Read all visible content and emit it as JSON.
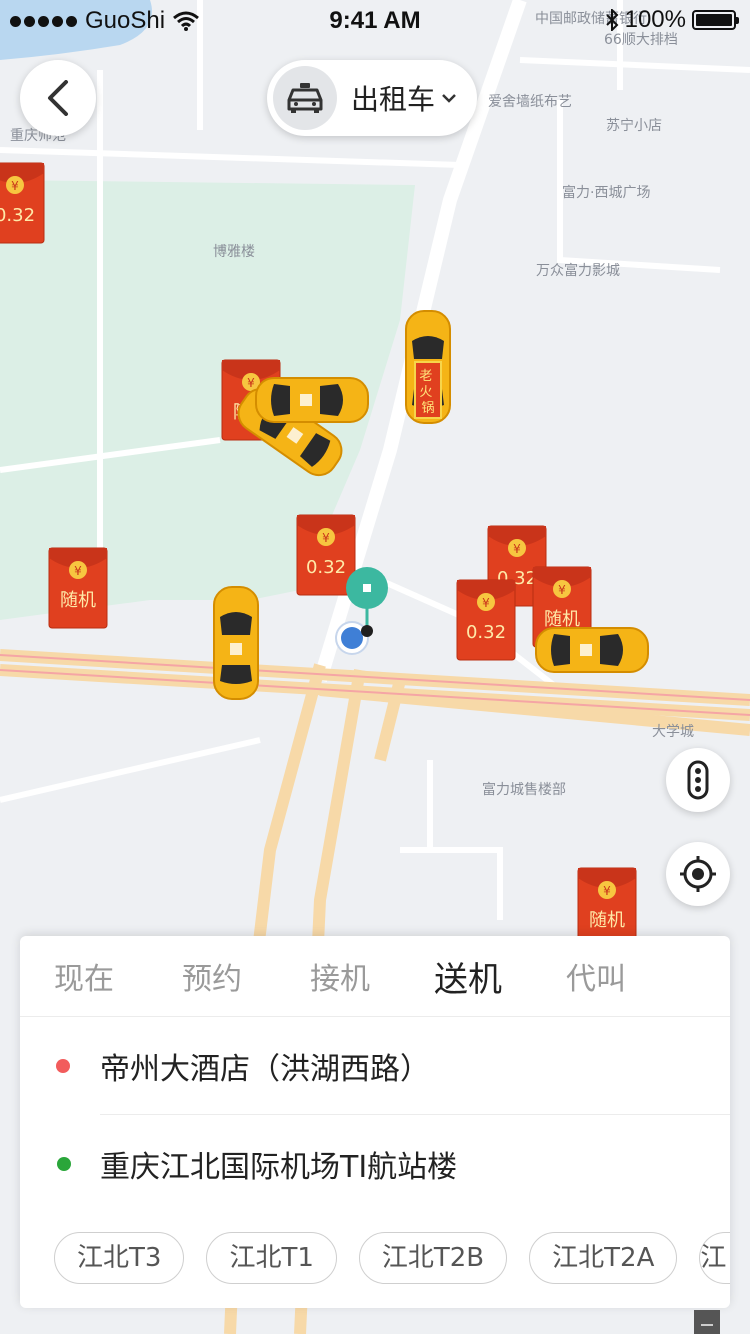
{
  "status_bar": {
    "carrier": "GuoShi",
    "time": "9:41 AM",
    "battery": "100%",
    "battery_level": 1.0
  },
  "header": {
    "service_label": "出租车"
  },
  "map": {
    "poi_labels": [
      "中国邮政储蓄银行",
      "66顺大排档",
      "爱舍墙纸布艺",
      "苏宁小店",
      "重庆师范",
      "富力·西城广场",
      "博雅楼",
      "万众富力影城",
      "大学城",
      "富力城售楼部"
    ],
    "red_packets": [
      "0.32",
      "随机",
      "0.32",
      "随机",
      "0.32",
      "0.32",
      "随机",
      "随机"
    ],
    "red_packet_currency": "¥",
    "taxi_banner": "老火锅"
  },
  "tabs": [
    "现在",
    "预约",
    "接机",
    "送机",
    "代叫"
  ],
  "active_tab": "送机",
  "addresses": {
    "start": "帝州大酒店（洪湖西路）",
    "end": "重庆江北国际机场TI航站楼"
  },
  "chips": [
    "江北T3",
    "江北T1",
    "江北T2B",
    "江北T2A",
    "江"
  ],
  "colors": {
    "start_dot": "#f25c5c",
    "end_dot": "#2aa63a",
    "pin": "#3cb8a0",
    "location": "#3f7fd6",
    "red_packet": "#e0401f",
    "taxi": "#f5b416"
  }
}
